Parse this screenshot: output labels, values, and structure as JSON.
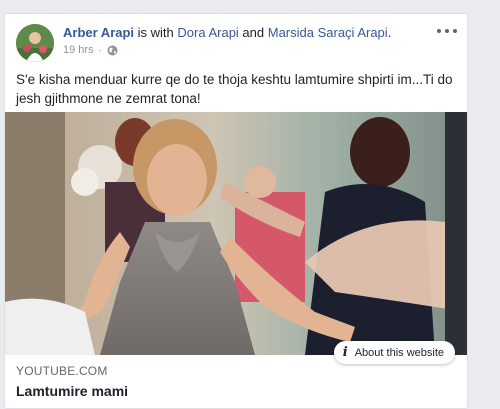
{
  "post": {
    "author": "Arber Arapi",
    "with_text": " is with ",
    "tagged_1": "Dora Arapi",
    "and_text": " and ",
    "tagged_2": "Marsida Saraçi Arapi",
    "period": ".",
    "time": "19 hrs",
    "dot": "·",
    "privacy_icon": "globe-icon",
    "more_icon": "more-options-icon",
    "text": "S'e kisha menduar kurre qe do te thoja keshtu lamtumire shpirti im...Ti do jesh gjithmone ne zemrat tona!"
  },
  "link_preview": {
    "about_label": "About this website",
    "info_icon_glyph": "i",
    "domain": "YOUTUBE.COM",
    "title": "Lamtumire mami"
  },
  "colors": {
    "link": "#385898",
    "page_background": "#e9ebee",
    "secondary_text": "#90949c"
  }
}
